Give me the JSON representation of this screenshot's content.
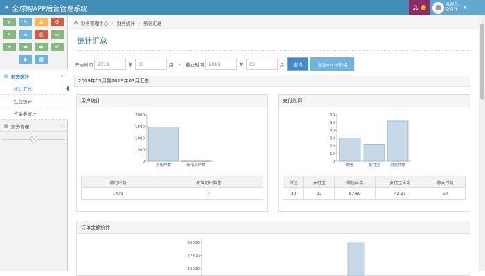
{
  "app": {
    "title": "全球购APP后台管理系统",
    "notif_count": "0",
    "welcome": "欢迎您,",
    "username": "张月元"
  },
  "shortcuts": [
    {
      "icon": "check-icon",
      "color": "#87b87f",
      "glyph": "✔"
    },
    {
      "icon": "pencil-icon",
      "color": "#6fb3e0",
      "glyph": "✎"
    },
    {
      "icon": "users-icon",
      "color": "#ffb752",
      "glyph": "♟"
    },
    {
      "icon": "cogs-icon",
      "color": "#d15b47",
      "glyph": "⚙"
    },
    {
      "icon": "edit-icon",
      "color": "#87b87f",
      "glyph": "✎"
    },
    {
      "icon": "list-icon",
      "color": "#6fb3e0",
      "glyph": "☰"
    },
    {
      "icon": "print-icon",
      "color": "#d15b47",
      "glyph": "⎙"
    },
    {
      "icon": "desktop-icon",
      "color": "#87b87f",
      "glyph": "▭"
    },
    {
      "icon": "plus-icon",
      "color": "#87b87f",
      "glyph": "+"
    },
    {
      "icon": "folder-icon",
      "color": "#87b87f",
      "glyph": "▬"
    },
    {
      "icon": "tag-icon",
      "color": "#87b87f",
      "glyph": "◆"
    },
    {
      "icon": "brush-icon",
      "color": "#87b87f",
      "glyph": "✐"
    },
    {
      "icon": "tags-icon",
      "color": "#6fb3e0",
      "glyph": "◆"
    },
    {
      "icon": "grid-icon",
      "color": "#6fb3e0",
      "glyph": "▦"
    }
  ],
  "nav": {
    "finance_stats": "财务统计",
    "stats_summary": "统计汇总",
    "red_packet_stats": "红包统计",
    "voucher_stats": "代金券统计",
    "finance_mgmt": "财务管理"
  },
  "breadcrumb": {
    "home": "财务管理中心",
    "level2": "财务统计",
    "level3": "统计汇总"
  },
  "page": {
    "title": "统计汇总"
  },
  "filter": {
    "start_label": "开始时间",
    "start_year": "2019",
    "year_unit": "年",
    "start_month": "03",
    "month_unit": "月",
    "dash": "-",
    "end_label": "截止时间",
    "end_year": "2019",
    "end_month": "03",
    "query_btn": "查询",
    "export_btn": "导出excel表格"
  },
  "range_text": "2019年03月到2019年03月汇总",
  "user_stats": {
    "title": "用户统计",
    "headers": [
      "总用户数",
      "新增用户数量"
    ],
    "values": [
      "1473",
      "7"
    ]
  },
  "pay_ratio": {
    "title": "支付比例",
    "headers": [
      "微信",
      "支付宝",
      "微信占比",
      "支付宝占比",
      "总支付数"
    ],
    "values": [
      "30",
      "22",
      "57.69",
      "42.31",
      "52"
    ]
  },
  "order_amount": {
    "title": "订单金额统计"
  },
  "chart_data": [
    {
      "type": "bar",
      "categories": [
        "总用户数",
        "新增用户数"
      ],
      "values": [
        1473,
        7
      ],
      "ylim": [
        0,
        2000
      ],
      "yticks": [
        "0",
        "500",
        "1000",
        "1500",
        "2000"
      ],
      "grid": false
    },
    {
      "type": "bar",
      "categories": [
        "微信",
        "支付宝",
        "总支付数"
      ],
      "values": [
        30,
        22,
        52
      ],
      "ylim": [
        0,
        60
      ],
      "yticks": [
        "0",
        "10",
        "20",
        "30",
        "40",
        "50",
        "60"
      ],
      "grid": false
    },
    {
      "type": "bar",
      "values": [
        20000
      ],
      "yticks": [
        "15000",
        "17500",
        "20000"
      ],
      "grid": false
    }
  ]
}
